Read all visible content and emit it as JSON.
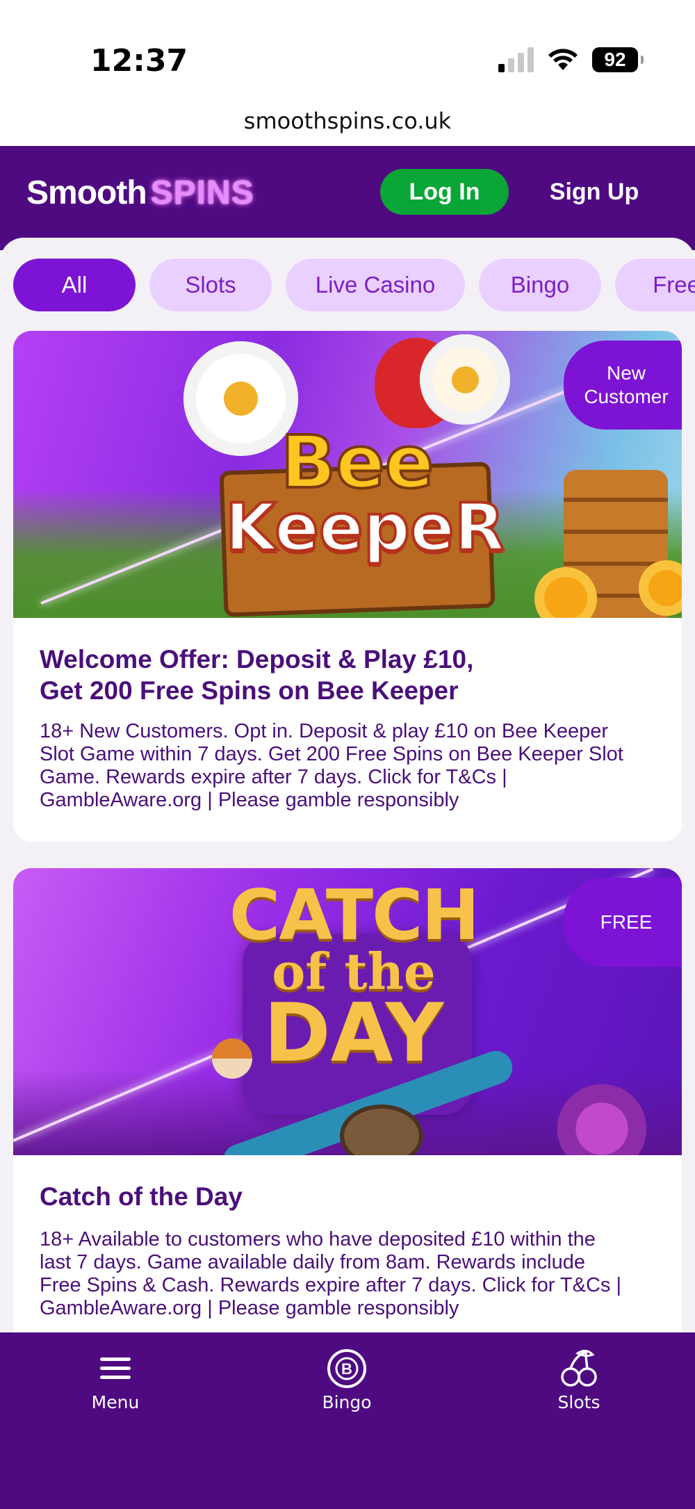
{
  "status_bar": {
    "time": "12:37",
    "battery": "92",
    "signal_bars_active": 1,
    "url": "smoothspins.co.uk"
  },
  "header": {
    "logo_word1": "Smooth",
    "logo_word2": "SPINS",
    "login_label": "Log In",
    "signup_label": "Sign Up",
    "colors": {
      "header_bg": "#4f0a82",
      "login_bg": "#0aa537",
      "logo_accent": "#e58cff"
    }
  },
  "tabs": [
    {
      "label": "All",
      "active": true
    },
    {
      "label": "Slots",
      "active": false
    },
    {
      "label": "Live Casino",
      "active": false
    },
    {
      "label": "Bingo",
      "active": false
    },
    {
      "label": "Free",
      "active": false
    }
  ],
  "cards": [
    {
      "badge_line1": "New",
      "badge_line2": "Customer",
      "banner_title_line1": "Bee",
      "banner_title_line2": "KeepeR",
      "title_line1": "Welcome Offer: Deposit & Play £10,",
      "title_line2": "Get 200 Free Spins on Bee Keeper",
      "text_line1": "18+ New Customers. Opt in. Deposit & play £10 on Bee Keeper",
      "text_line2": "Slot Game within 7 days. Get 200 Free Spins on Bee Keeper Slot",
      "text_line3": "Game. Rewards expire after 7 days. Click for T&Cs |",
      "text_line4": "GambleAware.org | Please gamble responsibly"
    },
    {
      "badge_line1": "FREE",
      "banner_title_line1": "CATCH",
      "banner_title_line2": "of the",
      "banner_title_line3": "DAY",
      "title_line1": "Catch of the Day",
      "text_line1": "18+ Available to customers who have deposited £10 within the",
      "text_line2": "last 7 days. Game available daily from 8am. Rewards include",
      "text_line3": "Free Spins & Cash. Rewards expire after 7 days. Click for T&Cs |",
      "text_line4": "GambleAware.org | Please gamble responsibly"
    }
  ],
  "bottom_nav": [
    {
      "label": "Menu",
      "icon": "menu-icon"
    },
    {
      "label": "Bingo",
      "icon": "bingo-ball-icon"
    },
    {
      "label": "Slots",
      "icon": "cherries-icon"
    }
  ],
  "colors": {
    "brand_purple": "#7d13d4",
    "text_purple": "#4a0f7a",
    "tab_bg": "#ead0ff"
  }
}
